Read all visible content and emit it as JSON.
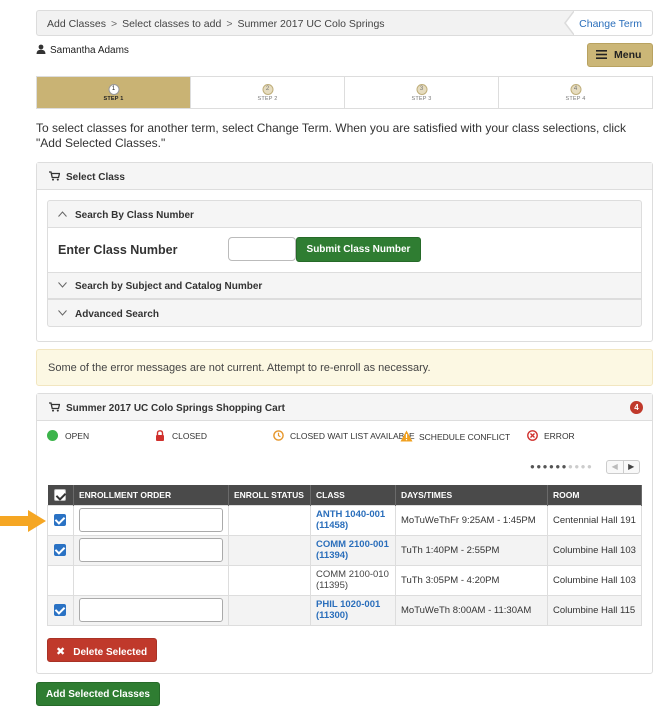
{
  "breadcrumb": {
    "items": [
      "Add Classes",
      "Select classes to add",
      "Summer 2017 UC Colo Springs"
    ],
    "change_term": "Change Term"
  },
  "user": {
    "name": "Samantha Adams",
    "menu_label": "Menu"
  },
  "steps": [
    {
      "num": "1",
      "label": "STEP 1",
      "active": true
    },
    {
      "num": "2",
      "label": "STEP 2",
      "active": false
    },
    {
      "num": "3",
      "label": "STEP 3",
      "active": false
    },
    {
      "num": "4",
      "label": "STEP 4",
      "active": false
    }
  ],
  "intro": "To select classes for another term, select Change Term.  When you are satisfied with your class selections, click \"Add Selected Classes.\"",
  "select_class": {
    "title": "Select Class",
    "search_by_number": "Search By Class Number",
    "enter_label": "Enter Class Number",
    "class_number_value": "",
    "submit_label": "Submit Class Number",
    "search_by_subject": "Search by Subject and Catalog Number",
    "advanced_search": "Advanced Search"
  },
  "warning": "Some of the error messages are not current. Attempt to re-enroll as necessary.",
  "cart": {
    "title": "Summer 2017 UC Colo Springs Shopping Cart",
    "count": "4",
    "legend": {
      "open": "OPEN",
      "closed": "CLOSED",
      "waitlist": "CLOSED WAIT LIST AVAILABLE",
      "conflict": "SCHEDULE CONFLICT",
      "error": "ERROR"
    },
    "columns": [
      "ENROLLMENT ORDER",
      "ENROLL STATUS",
      "CLASS",
      "DAYS/TIMES",
      "ROOM"
    ],
    "rows": [
      {
        "checked": true,
        "has_input": true,
        "class": "ANTH 1040-001 (11458)",
        "link": true,
        "days": "MoTuWeThFr 9:25AM - 1:45PM",
        "room": "Centennial Hall 191"
      },
      {
        "checked": true,
        "has_input": true,
        "class": "COMM 2100-001 (11394)",
        "link": true,
        "days": "TuTh 1:40PM - 2:55PM",
        "room": "Columbine Hall 103"
      },
      {
        "checked": false,
        "has_input": false,
        "class": "COMM 2100-010 (11395)",
        "link": false,
        "days": "TuTh 3:05PM - 4:20PM",
        "room": "Columbine Hall 103"
      },
      {
        "checked": true,
        "has_input": true,
        "class": "PHIL 1020-001 (11300)",
        "link": true,
        "days": "MoTuWeTh 8:00AM - 11:30AM",
        "room": "Columbine Hall 115"
      }
    ],
    "delete_label": "Delete Selected"
  },
  "add_selected_label": "Add Selected Classes",
  "colors": {
    "gold": "#c9b374",
    "green": "#2f7d32",
    "red": "#c0392b",
    "link": "#2a6ebb",
    "arrow": "#f5a623"
  }
}
